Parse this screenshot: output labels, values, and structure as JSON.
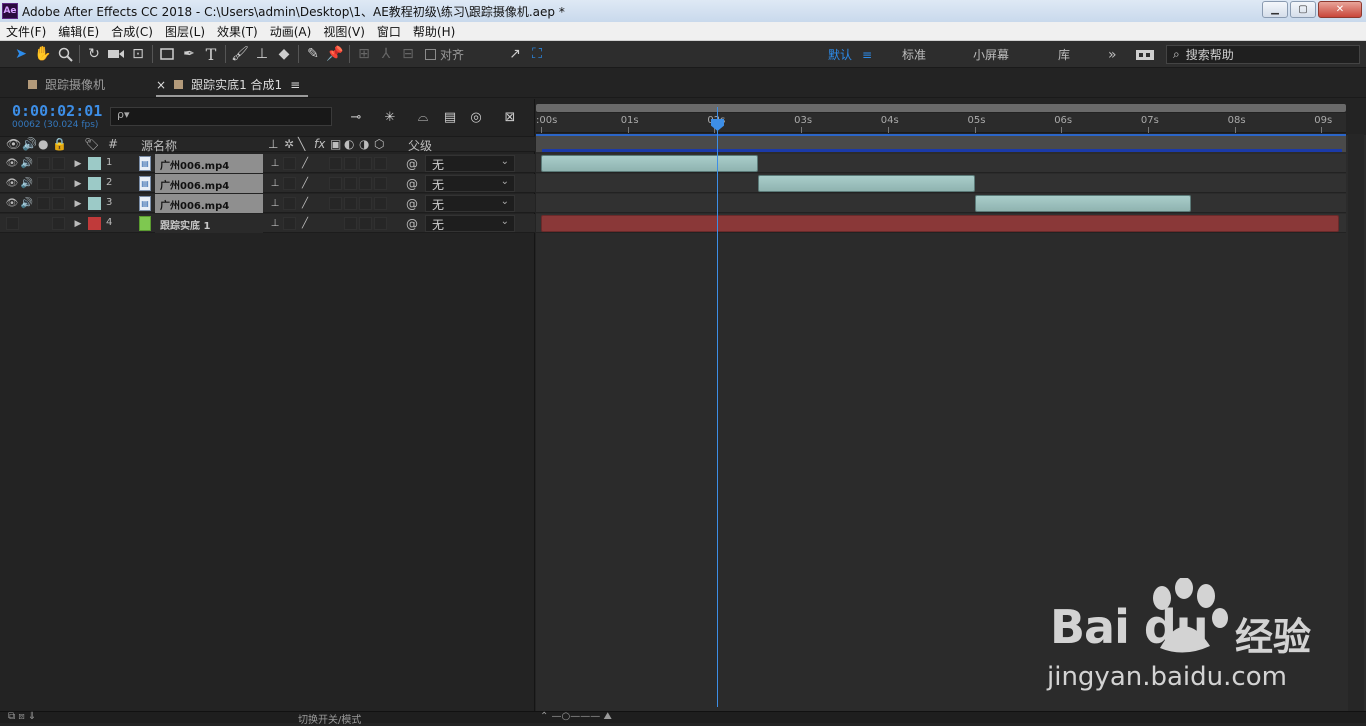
{
  "window": {
    "app_icon": "Ae",
    "title": "Adobe After Effects CC 2018 - C:\\Users\\admin\\Desktop\\1、AE教程初级\\练习\\跟踪摄像机.aep *",
    "controls": {
      "minimize": "▁",
      "maximize": "▢",
      "close": "✕"
    }
  },
  "menu": [
    "文件(F)",
    "编辑(E)",
    "合成(C)",
    "图层(L)",
    "效果(T)",
    "动画(A)",
    "视图(V)",
    "窗口",
    "帮助(H)"
  ],
  "toolbar": {
    "snap_label": "对齐",
    "workspaces": [
      "默认",
      "标准",
      "小屏幕",
      "库"
    ],
    "more": "»",
    "search_placeholder": "搜索帮助"
  },
  "panel_tabs": [
    {
      "label": "跟踪摄像机"
    },
    {
      "label": "跟踪实底1 合成1",
      "close": "×",
      "menu": "≡"
    }
  ],
  "timeline": {
    "current_time": "0:00:02:01",
    "frame_info": "00062 (30.024 fps)",
    "search_placeholder": "ρ▾",
    "columns": {
      "hash": "#",
      "source_name": "源名称",
      "parent": "父级",
      "fx": "fx"
    },
    "ruler_ticks": [
      ":00s",
      "01s",
      "02s",
      "03s",
      "04s",
      "05s",
      "06s",
      "07s",
      "08s",
      "09s"
    ],
    "playhead_seconds": 2.03,
    "duration_seconds": 9.4,
    "layers": [
      {
        "index": "1",
        "name": "广州006.mp4",
        "label_color": "#9ccac7",
        "parent": "无",
        "in_seconds": 0.0,
        "out_seconds": 2.5,
        "type": "footage"
      },
      {
        "index": "2",
        "name": "广州006.mp4",
        "label_color": "#9ccac7",
        "parent": "无",
        "in_seconds": 2.5,
        "out_seconds": 5.0,
        "type": "footage"
      },
      {
        "index": "3",
        "name": "广州006.mp4",
        "label_color": "#9ccac7",
        "parent": "无",
        "in_seconds": 5.0,
        "out_seconds": 7.5,
        "type": "footage"
      },
      {
        "index": "4",
        "name": "跟踪实底 1",
        "label_color": "#c03a3a",
        "parent": "无",
        "in_seconds": 0.0,
        "out_seconds": 9.2,
        "type": "solid"
      }
    ]
  },
  "status": {
    "toggle_label": "切换开关/模式"
  },
  "watermark": {
    "brand": "Bai du",
    "brand_cn": "经验",
    "url": "jingyan.baidu.com"
  }
}
